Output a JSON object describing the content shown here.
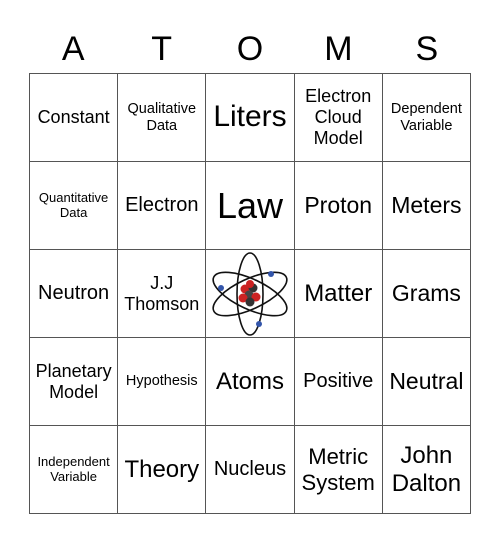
{
  "card": {
    "title_letters": [
      "A",
      "T",
      "O",
      "M",
      "S"
    ],
    "free_space_icon": "atom-icon",
    "cells": [
      [
        "Constant",
        "Qualitative\nData",
        "Liters",
        "Electron\nCloud\nModel",
        "Dependent\nVariable"
      ],
      [
        "Quantitative\nData",
        "Electron",
        "Law",
        "Proton",
        "Meters"
      ],
      [
        "Neutron",
        "J.J\nThomson",
        "",
        "Matter",
        "Grams"
      ],
      [
        "Planetary\nModel",
        "Hypothesis",
        "Atoms",
        "Positive",
        "Neutral"
      ],
      [
        "Independent\nVariable",
        "Theory",
        "Nucleus",
        "Metric\nSystem",
        "John\nDalton"
      ]
    ]
  },
  "colors": {
    "grid_line": "#555555",
    "proton": "#cc2222",
    "neutron": "#333333",
    "electron": "#3355aa"
  }
}
